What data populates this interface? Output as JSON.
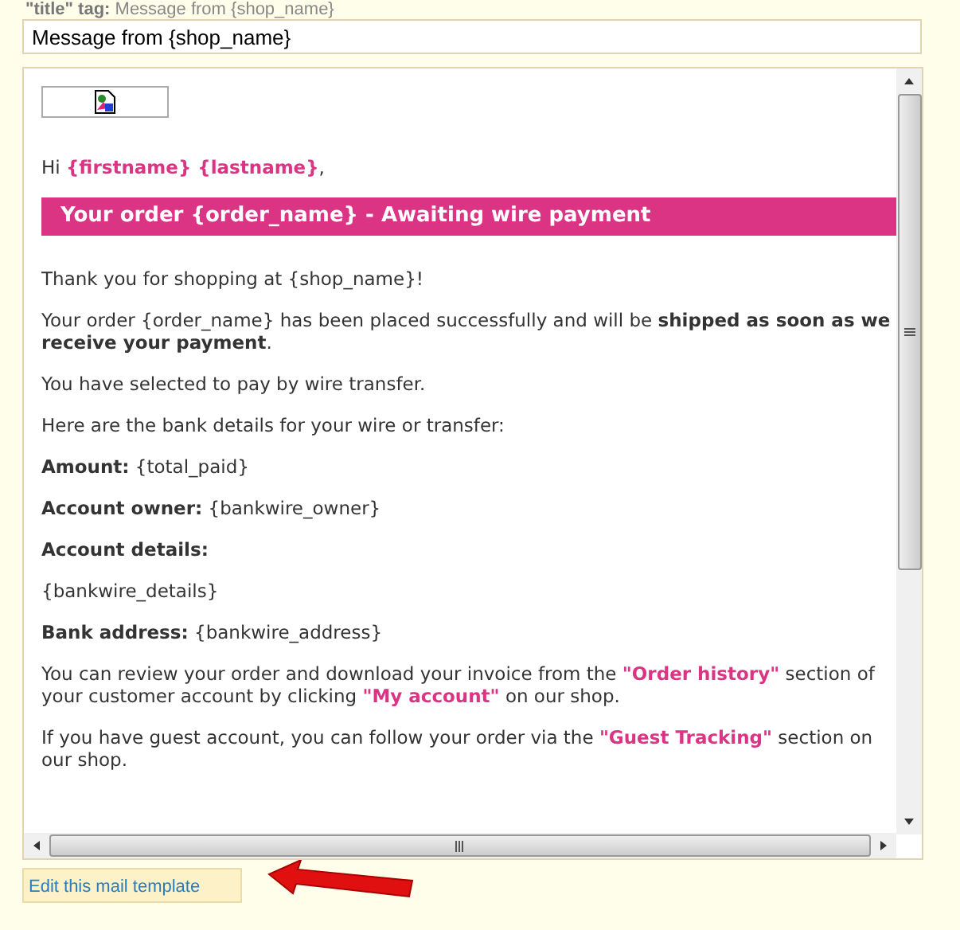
{
  "title_tag": {
    "label": "\"title\" tag:",
    "value": "Message from {shop_name}"
  },
  "title_field": {
    "value": "Message from {shop_name}"
  },
  "preview": {
    "blocks": [
      {
        "kind": "image"
      },
      {
        "kind": "paragraph",
        "segments": [
          {
            "kind": "text",
            "text": "Hi "
          },
          {
            "kind": "highlight",
            "text": "{firstname} {lastname}"
          },
          {
            "kind": "text",
            "text": ","
          }
        ]
      },
      {
        "kind": "banner",
        "text": "Your order {order_name} - Awaiting wire payment"
      },
      {
        "kind": "paragraph",
        "segments": [
          {
            "kind": "text",
            "text": "Thank you for shopping at {shop_name}!"
          }
        ]
      },
      {
        "kind": "paragraph",
        "segments": [
          {
            "kind": "text",
            "text": "Your order {order_name} has been placed successfully and will be "
          },
          {
            "kind": "bold",
            "text": "shipped as soon as we receive your payment"
          },
          {
            "kind": "text",
            "text": "."
          }
        ]
      },
      {
        "kind": "paragraph",
        "segments": [
          {
            "kind": "text",
            "text": "You have selected to pay by wire transfer."
          }
        ]
      },
      {
        "kind": "paragraph",
        "segments": [
          {
            "kind": "text",
            "text": "Here are the bank details for your wire or transfer:"
          }
        ]
      },
      {
        "kind": "paragraph",
        "segments": [
          {
            "kind": "bold",
            "text": "Amount:"
          },
          {
            "kind": "text",
            "text": " {total_paid}"
          }
        ]
      },
      {
        "kind": "paragraph",
        "segments": [
          {
            "kind": "bold",
            "text": "Account owner:"
          },
          {
            "kind": "text",
            "text": " {bankwire_owner}"
          }
        ]
      },
      {
        "kind": "paragraph",
        "segments": [
          {
            "kind": "bold",
            "text": "Account details:"
          }
        ]
      },
      {
        "kind": "paragraph",
        "segments": [
          {
            "kind": "text",
            "text": "{bankwire_details}"
          }
        ]
      },
      {
        "kind": "paragraph",
        "segments": [
          {
            "kind": "bold",
            "text": "Bank address:"
          },
          {
            "kind": "text",
            "text": " {bankwire_address}"
          }
        ]
      },
      {
        "kind": "paragraph",
        "segments": [
          {
            "kind": "text",
            "text": "You can review your order and download your invoice from the "
          },
          {
            "kind": "highlight",
            "text": "\"Order history\""
          },
          {
            "kind": "text",
            "text": " section of your customer account by clicking "
          },
          {
            "kind": "highlight",
            "text": "\"My account\""
          },
          {
            "kind": "text",
            "text": " on our shop."
          }
        ]
      },
      {
        "kind": "paragraph",
        "segments": [
          {
            "kind": "text",
            "text": "If you have guest account, you can follow your order via the "
          },
          {
            "kind": "highlight",
            "text": "\"Guest Tracking\""
          },
          {
            "kind": "text",
            "text": " section on our shop."
          }
        ]
      }
    ]
  },
  "edit_link": "Edit this mail template"
}
